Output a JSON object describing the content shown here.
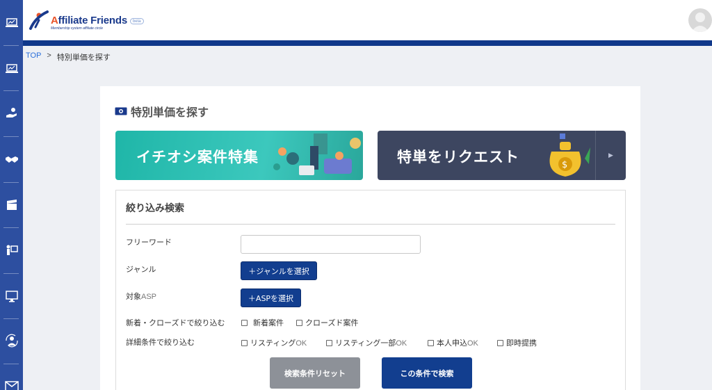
{
  "app": {
    "logo_title_a": "A",
    "logo_title_rest": "ffiliate Friends",
    "logo_subtitle": "Membership system affiliate circle",
    "logo_badge": "beta"
  },
  "sidebar": {
    "icons": [
      "laptop-chart-icon",
      "laptop-chart-icon",
      "hand-coin-icon",
      "handshake-icon",
      "clapperboard-icon",
      "presenter-icon",
      "monitor-icon",
      "user-sync-icon",
      "mail-icon"
    ]
  },
  "breadcrumb": {
    "home": "TOP",
    "separator": ">",
    "current": "特別単価を探す"
  },
  "page": {
    "title": "特別単価を探す"
  },
  "banners": {
    "left": "イチオシ案件特集",
    "right": "特単をリクエスト"
  },
  "search": {
    "title": "絞り込み検索",
    "freeword_label": "フリーワード",
    "freeword_value": "",
    "genre_label": "ジャンル",
    "genre_button": "＋ジャンルを選択",
    "asp_label_jp": "対象",
    "asp_label_en": "ASP",
    "asp_button": "＋ASPを選択",
    "new_close_label": "新着・クローズドで絞り込む",
    "new_close_options": [
      "新着案件",
      "クローズド案件"
    ],
    "detail_label": "詳細条件で絞り込む",
    "detail_options": [
      {
        "jp": "リスティング",
        "en": "OK"
      },
      {
        "jp": "リスティング一部",
        "en": "OK"
      },
      {
        "jp": "本人申込",
        "en": "OK"
      },
      {
        "jp": "即時提携",
        "en": ""
      }
    ],
    "reset_button": "検索条件リセット",
    "submit_button": "この条件で検索"
  },
  "colors": {
    "sidebar": "#2d4fa0",
    "header_bar": "#10388a",
    "primary_button": "#123e8f",
    "reset_button": "#8d9198",
    "banner_left": "#1fb6a8",
    "banner_right": "#3d4660",
    "link": "#2a6fdb"
  }
}
